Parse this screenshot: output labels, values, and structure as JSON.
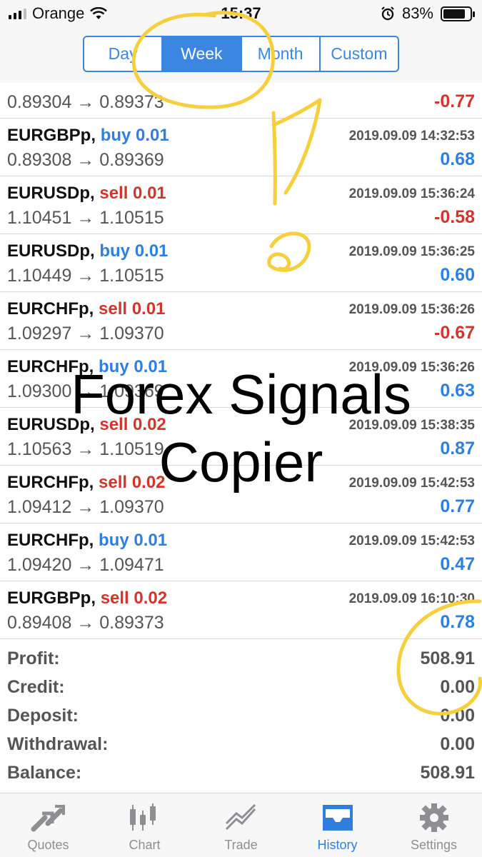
{
  "status_bar": {
    "carrier": "Orange",
    "time": "15:37",
    "battery": "83%",
    "battery_level": 0.83
  },
  "period_tabs": [
    {
      "label": "Day",
      "active": false
    },
    {
      "label": "Week",
      "active": true
    },
    {
      "label": "Month",
      "active": false
    },
    {
      "label": "Custom",
      "active": false
    }
  ],
  "partial_deal": {
    "prices": "0.89304 → 0.89373",
    "profit": "-0.77"
  },
  "deals": [
    {
      "symbol": "EURGBPp,",
      "direction": "buy",
      "volume": "0.01",
      "time": "2019.09.09 14:32:53",
      "prices": "0.89308 → 0.89369",
      "profit": "0.68"
    },
    {
      "symbol": "EURUSDp,",
      "direction": "sell",
      "volume": "0.01",
      "time": "2019.09.09 15:36:24",
      "prices": "1.10451 → 1.10515",
      "profit": "-0.58"
    },
    {
      "symbol": "EURUSDp,",
      "direction": "buy",
      "volume": "0.01",
      "time": "2019.09.09 15:36:25",
      "prices": "1.10449 → 1.10515",
      "profit": "0.60"
    },
    {
      "symbol": "EURCHFp,",
      "direction": "sell",
      "volume": "0.01",
      "time": "2019.09.09 15:36:26",
      "prices": "1.09297 → 1.09370",
      "profit": "-0.67"
    },
    {
      "symbol": "EURCHFp,",
      "direction": "buy",
      "volume": "0.01",
      "time": "2019.09.09 15:36:26",
      "prices": "1.09300 → 1.09369",
      "profit": "0.63"
    },
    {
      "symbol": "EURUSDp,",
      "direction": "sell",
      "volume": "0.02",
      "time": "2019.09.09 15:38:35",
      "prices": "1.10563 → 1.10519",
      "profit": "0.87"
    },
    {
      "symbol": "EURCHFp,",
      "direction": "sell",
      "volume": "0.02",
      "time": "2019.09.09 15:42:53",
      "prices": "1.09412 → 1.09370",
      "profit": "0.77"
    },
    {
      "symbol": "EURCHFp,",
      "direction": "buy",
      "volume": "0.01",
      "time": "2019.09.09 15:42:53",
      "prices": "1.09420 → 1.09471",
      "profit": "0.47"
    },
    {
      "symbol": "EURGBPp,",
      "direction": "sell",
      "volume": "0.02",
      "time": "2019.09.09 16:10:30",
      "prices": "0.89408 → 0.89373",
      "profit": "0.78"
    }
  ],
  "summary": [
    {
      "label": "Profit:",
      "value": "508.91"
    },
    {
      "label": "Credit:",
      "value": "0.00"
    },
    {
      "label": "Deposit:",
      "value": "0.00"
    },
    {
      "label": "Withdrawal:",
      "value": "0.00"
    },
    {
      "label": "Balance:",
      "value": "508.91"
    }
  ],
  "watermark": {
    "line1": "Forex Signals",
    "line2": "Copier"
  },
  "tab_bar": [
    {
      "label": "Quotes",
      "icon": "quotes-icon",
      "active": false
    },
    {
      "label": "Chart",
      "icon": "chart-icon",
      "active": false
    },
    {
      "label": "Trade",
      "icon": "trade-icon",
      "active": false
    },
    {
      "label": "History",
      "icon": "history-icon",
      "active": true
    },
    {
      "label": "Settings",
      "icon": "settings-icon",
      "active": false
    }
  ],
  "colors": {
    "accent": "#3a86e0",
    "profit_positive": "#2e7fe0",
    "profit_negative": "#d2352b",
    "annotation": "#f5cf3c"
  }
}
